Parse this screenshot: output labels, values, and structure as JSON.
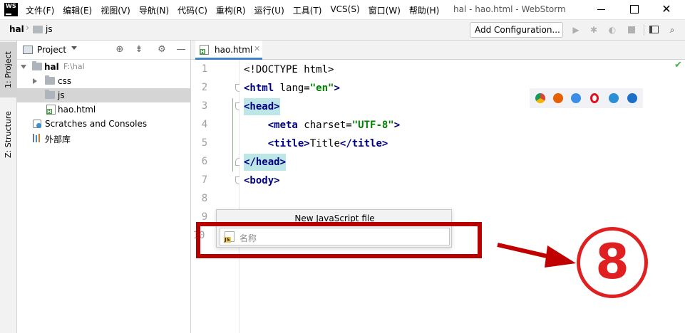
{
  "app": {
    "logo_text": "WS",
    "window_title": "hal - hao.html - WebStorm"
  },
  "menu": [
    "文件(F)",
    "编辑(E)",
    "视图(V)",
    "导航(N)",
    "代码(C)",
    "重构(R)",
    "运行(U)",
    "工具(T)",
    "VCS(S)",
    "窗口(W)",
    "帮助(H)"
  ],
  "navbar": {
    "root": "hal",
    "folder": "js",
    "add_configuration": "Add Configuration..."
  },
  "toolstrip": {
    "project_tab": "1: Project",
    "structure_tab": "Z: Structure"
  },
  "project_panel": {
    "title": "Project",
    "tree": {
      "root_name": "hal",
      "root_path": "F:\\hal",
      "css": "css",
      "js": "js",
      "html_file": "hao.html",
      "scratches": "Scratches and Consoles",
      "libraries": "外部库"
    }
  },
  "editor": {
    "tab_label": "hao.html",
    "line_numbers": [
      "1",
      "2",
      "3",
      "4",
      "5",
      "6",
      "7",
      "8",
      "9",
      "10"
    ],
    "lines": {
      "l1": "<!DOCTYPE html>",
      "l2_tag_open": "<html",
      "l2_attr": " lang=",
      "l2_value": "\"en\"",
      "l2_close": ">",
      "l3": "<head>",
      "l4_tag": "<meta",
      "l4_attr": " charset=",
      "l4_value": "\"UTF-8\"",
      "l4_close": ">",
      "l5_open": "<title>",
      "l5_text": "Title",
      "l5_close": "</title>",
      "l6": "</head>",
      "l7": "<body>"
    }
  },
  "popup": {
    "title": "New JavaScript file",
    "placeholder": "名称"
  },
  "annotation": {
    "step_number": "⑧",
    "box_color": "#b80000",
    "circle_color": "#e02020"
  },
  "colors": {
    "tag": "#000080",
    "string": "#008000",
    "highlight": "#bde6e6",
    "selection": "#d5d5d5"
  }
}
